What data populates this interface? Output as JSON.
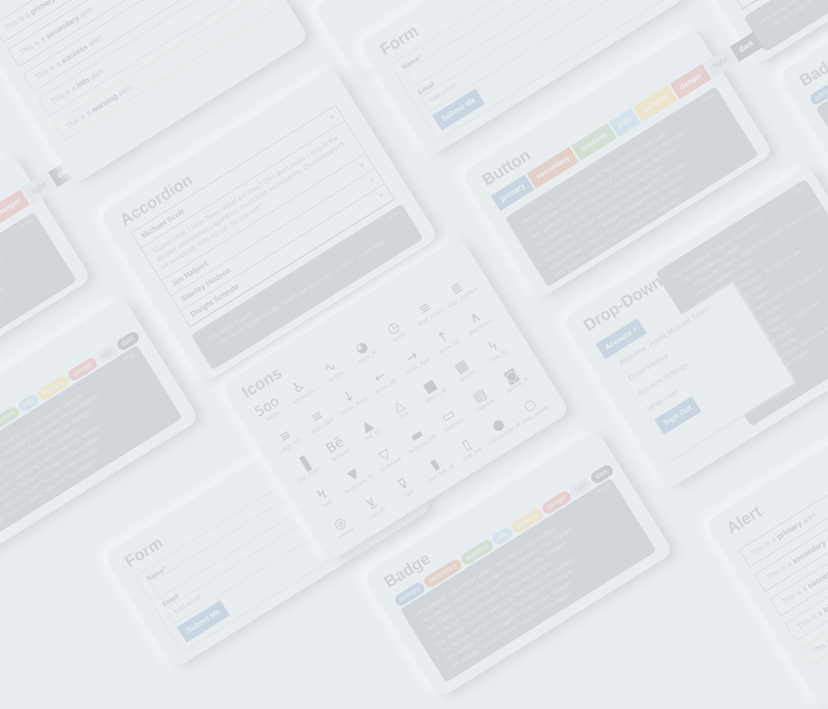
{
  "colors": {
    "background": "#e8edf0",
    "primary": "#c9d5e1",
    "secondary": "#e3d0c8",
    "success": "#d3dfd2",
    "info": "#d5e2ec",
    "warning": "#ebe5cc",
    "danger": "#e5cfcf",
    "light": "#e3e7ea",
    "dark": "#c7ccd0",
    "code_bg": "#d1d6da"
  },
  "alert": {
    "title": "Alert",
    "items": [
      {
        "prefix": "This is a ",
        "strong": "primary",
        "suffix": " alert.",
        "color": "#cfd6de"
      },
      {
        "prefix": "This is a ",
        "strong": "secondary",
        "suffix": " alert.",
        "color": "#e5cfc8"
      },
      {
        "prefix": "This is a ",
        "strong": "success",
        "suffix": " alert.",
        "color": "#d2ddd1"
      },
      {
        "prefix": "This is a ",
        "strong": "info",
        "suffix": " alert.",
        "color": "#d3e1ec"
      },
      {
        "prefix": "This is a ",
        "strong": "warning",
        "suffix": " alert.",
        "color": "#ebe3c9"
      }
    ]
  },
  "accordion": {
    "title": "Accordion",
    "slides": [
      {
        "heading": "Michael Scott",
        "chevron": "chevron-up",
        "body": "\"Guess what, I have flaws. What are they? Oh I don't know. I sing in the shower. Sometimes I spend too much time volunteering. Occasionally I'll hit somebody with my car. So sue me.\""
      },
      {
        "heading": "Jim Halpert",
        "chevron": "chevron-down"
      },
      {
        "heading": "Stanley Hudson",
        "chevron": "chevron-down"
      },
      {
        "heading": "Dwight Schrute",
        "chevron": "chevron-down"
      }
    ],
    "code_lang": "html",
    "code": [
      "<ks-accordion>",
      "  <ks-accordion-slide heading=\"Michael Scott\" expanded>"
    ]
  },
  "form": {
    "title": "Form",
    "name_label": "Name",
    "required_mark": "*",
    "name_value": "",
    "email_label": "Email",
    "email_value": "bad.email",
    "submit_label": "Submit Me"
  },
  "button": {
    "title": "Button",
    "buttons": [
      "primary",
      "secondary",
      "success",
      "info",
      "warning",
      "danger",
      "light",
      "dark"
    ],
    "code_lang": "html",
    "code": [
      "<ks-button color=\"primary\">primary</ks-button>",
      "<ks-button color=\"secondary\">secondary</ks-button>",
      "<ks-button color=\"success\">success</ks-button>",
      "<ks-button color=\"info\">info</ks-button>",
      "<ks-button color=\"warning\">warning</ks-button>",
      "<ks-button color=\"danger\">danger</ks-button>",
      "<ks-button color=\"light\">light</ks-button>",
      "<ks-button color=\"dark\">dark</ks-button>"
    ]
  },
  "badge": {
    "title": "Badge",
    "badges": [
      "primary",
      "secondary",
      "success",
      "info",
      "warning",
      "danger",
      "light",
      "dark"
    ],
    "code_lang": "html",
    "code": [
      "<ks-badge color=\"primary\">primary</ks-badge>",
      "<ks-badge color=\"secondary\">secondary</ks-badge>",
      "<ks-badge color=\"success\">success</ks-badge>",
      "<ks-badge color=\"info\">info</ks-badge>",
      "<ks-badge color=\"warning\">warning</ks-badge>",
      "<ks-badge color=\"danger\">danger</ks-badge>",
      "<ks-badge color=\"light\">light</ks-badge>",
      "<ks-badge color=\"dark\">dark</ks-badge>"
    ]
  },
  "icons": {
    "title": "Icons",
    "items": [
      "500px",
      "accessible",
      "activity",
      "alarm_fill",
      "alarm",
      "align_center",
      "align_justified",
      "align_left",
      "align_right",
      "arrow_down",
      "arrow_left",
      "arrow_right",
      "arrow_up",
      "attachment",
      "bar_chart",
      "behance",
      "bell_fill",
      "bell",
      "blocks_fill",
      "blocks",
      "bolt_fill",
      "bolt",
      "bookmark_fill",
      "bookmark",
      "briefcase_fill",
      "briefcase",
      "calendar",
      "camera_fill",
      "camera",
      "cart_fill",
      "cart",
      "chat_box_fill",
      "chat_box",
      "chat_bubble_fill",
      "chat_bubble"
    ]
  },
  "dropdown": {
    "title": "Drop-Down",
    "trigger_label": "Account",
    "menu_items": [
      "Welcome, Agent Michael Scarn!",
      "Order History",
      "Account Settings",
      "Wish Lists"
    ],
    "signout_label": "Sign Out",
    "code_lang": "html",
    "code": [
      "<ks-dropdown label=\"Account\">",
      "  <ks-dropdown-item>",
      "    <span>Welcome, Agent Michael Scarn!</span>",
      "  </ks-dropdown-item>",
      "  <ks-dropdown-item>",
      "    <a href=\"#\">Order History</a>",
      "  </ks-dropdown-item>",
      "  <ks-dropdown-item>",
      "    <a href=\"#\">Account Settings</a>",
      "  </ks-dropdown-item>",
      "  <ks-dropdown-item>",
      "    <a href=\"#\">Wish Lists</a>",
      "  </ks-dropdown-item>",
      "  <ks-dropdown-item>",
      "    <ks-button>Sign Out</ks-button>",
      "  </ks-dropdown-item>",
      "</ks-dropdown>"
    ]
  }
}
